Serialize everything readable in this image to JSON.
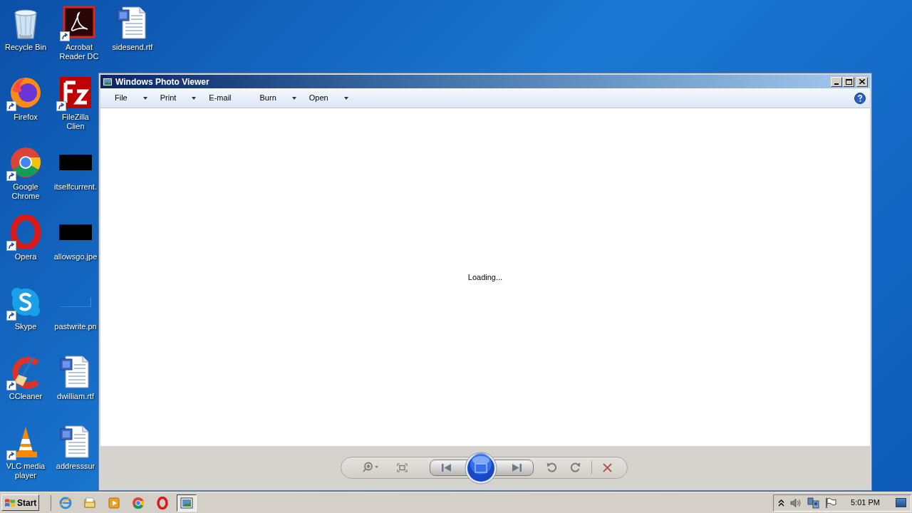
{
  "desktop": {
    "rows": [
      [
        {
          "label": "Recycle Bin",
          "kind": "recycle-bin",
          "shortcut": false
        },
        {
          "label": "Acrobat Reader DC",
          "kind": "pdf",
          "shortcut": true
        },
        {
          "label": "sidesend.rtf",
          "kind": "word-doc",
          "shortcut": false
        }
      ],
      [
        {
          "label": "Firefox",
          "kind": "firefox",
          "shortcut": true
        },
        {
          "label": "FileZilla Clien",
          "kind": "filezilla",
          "shortcut": true
        }
      ],
      [
        {
          "label": "Google Chrome",
          "kind": "chrome",
          "shortcut": true
        },
        {
          "label": "itselfcurrent.",
          "kind": "dark-image",
          "shortcut": false
        }
      ],
      [
        {
          "label": "Opera",
          "kind": "opera",
          "shortcut": true
        },
        {
          "label": "allowsgo.jpe",
          "kind": "dark-image",
          "shortcut": false
        }
      ],
      [
        {
          "label": "Skype",
          "kind": "skype",
          "shortcut": true
        },
        {
          "label": "pastwrite.pn",
          "kind": "blank-image",
          "shortcut": false
        }
      ],
      [
        {
          "label": "CCleaner",
          "kind": "ccleaner",
          "shortcut": true
        },
        {
          "label": "dwilliam.rtf",
          "kind": "word-doc",
          "shortcut": false
        }
      ],
      [
        {
          "label": "VLC media player",
          "kind": "vlc",
          "shortcut": true
        },
        {
          "label": "addresssur",
          "kind": "word-doc",
          "shortcut": false
        }
      ]
    ]
  },
  "window": {
    "title": "Windows Photo Viewer",
    "menu": [
      {
        "label": "File",
        "dropdown": true
      },
      {
        "label": "Print",
        "dropdown": true
      },
      {
        "label": "E-mail",
        "dropdown": false
      },
      {
        "label": "Burn",
        "dropdown": true
      },
      {
        "label": "Open",
        "dropdown": true
      }
    ],
    "status": "Loading..."
  },
  "taskbar": {
    "start": "Start",
    "apps": [
      {
        "kind": "ie",
        "selected": false
      },
      {
        "kind": "folder",
        "selected": false
      },
      {
        "kind": "media",
        "selected": false
      },
      {
        "kind": "chrome",
        "selected": false
      },
      {
        "kind": "opera",
        "selected": false
      },
      {
        "kind": "photo-viewer",
        "selected": true
      }
    ],
    "clock": "5:01 PM"
  }
}
